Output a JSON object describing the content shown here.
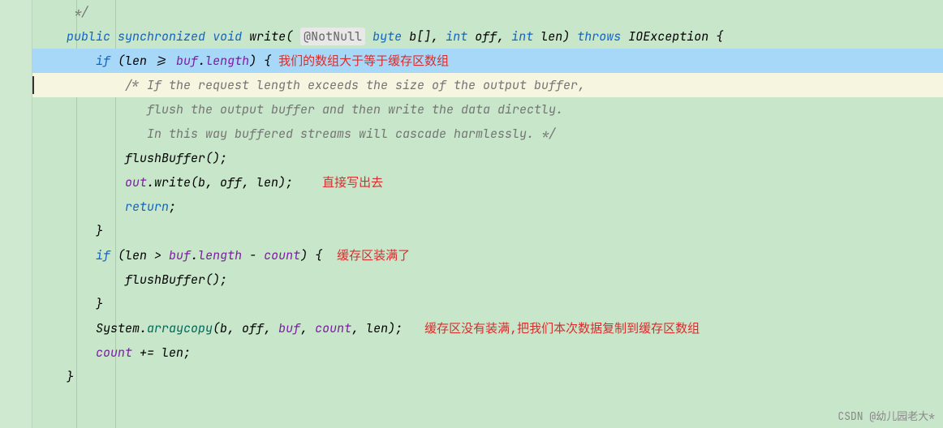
{
  "code": {
    "comment_end": "*/",
    "sig": {
      "public": "public",
      "sync": "synchronized",
      "void": "void",
      "method": "write",
      "anno": "@NotNull",
      "byte": "byte",
      "param1": " b[], ",
      "int1": "int",
      "off": " off, ",
      "int2": "int",
      "len": " len) ",
      "throws": "throws",
      "exc": " IOException {"
    },
    "if1": {
      "if": "if",
      "open": " (len >= ",
      "buf": "buf",
      "dot": ".",
      "length": "length",
      "close": ") { ",
      "note": "我们的数组大于等于缓存区数组"
    },
    "c1": "/* If the request length exceeds the size of the output buffer,",
    "c2": "   flush the output buffer and then write the data directly.",
    "c3": "   In this way buffered streams will cascade harmlessly. */",
    "flush1": "flushBuffer();",
    "outwrite": {
      "out": "out",
      "rest": ".write(b, off, len);",
      "note": "直接写出去"
    },
    "return": "return",
    "semicolon": ";",
    "rbrace": "}",
    "if2": {
      "if": "if",
      "open": " (len > ",
      "buf": "buf",
      "dot": ".",
      "length": "length",
      "mid": " - ",
      "count": "count",
      "close": ") {  ",
      "note": "缓存区装满了"
    },
    "flush2": "flushBuffer();",
    "arraycopy": {
      "class": "System.",
      "method": "arraycopy",
      "args_open": "(b, off, ",
      "buf": "buf",
      "sep": ", ",
      "count": "count",
      "args_close": ", len);",
      "note": "缓存区没有装满,把我们本次数据复制到缓存区数组"
    },
    "countinc": {
      "count": "count",
      "rest": " += len;"
    }
  },
  "watermark": "CSDN @幼儿园老大*"
}
